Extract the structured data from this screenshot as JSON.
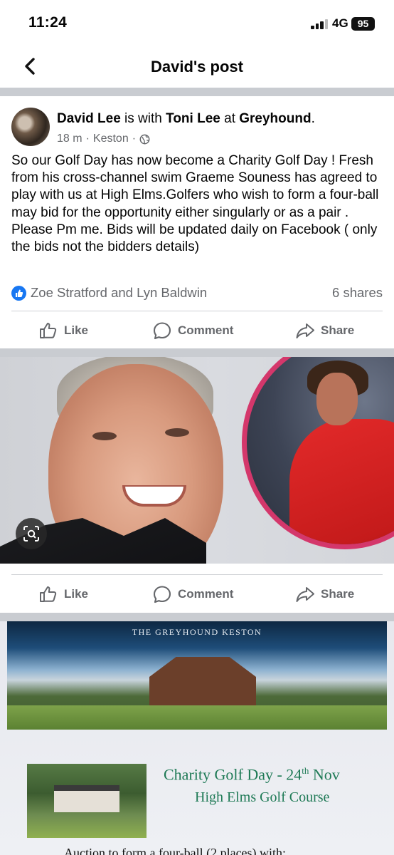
{
  "status_bar": {
    "time": "11:24",
    "network": "4G",
    "battery": "95"
  },
  "header": {
    "title": "David's post"
  },
  "post": {
    "author": "David Lee",
    "with_text": " is with ",
    "tagged": "Toni Lee",
    "at_text": " at ",
    "place": "Greyhound",
    "period": ".",
    "time": "18 m",
    "location": "Keston",
    "sep": "·",
    "body": "So our Golf Day has now become a Charity Golf Day ! Fresh from his cross-channel swim Graeme Souness has agreed to play with us at High Elms.Golfers who wish to form a four-ball may bid for the opportunity either singularly or as a pair . Please Pm me. Bids will be updated daily on Facebook ( only the bids not the bidders details)",
    "reactions": "Zoe Stratford and Lyn Baldwin",
    "shares": "6 shares"
  },
  "actions": {
    "like": "Like",
    "comment": "Comment",
    "share": "Share"
  },
  "poster": {
    "header": "THE GREYHOUND KESTON",
    "title": "Charity Golf Day - 24",
    "title_sup": "th",
    "title_end": " Nov",
    "subtitle": "High Elms Golf Course",
    "bottom": "Auction to form a four-ball (2 places) with:"
  },
  "colors": {
    "accent": "#1877f2",
    "muted": "#65676b",
    "poster_green": "#1f7a56",
    "inset_border": "#d4376b"
  }
}
